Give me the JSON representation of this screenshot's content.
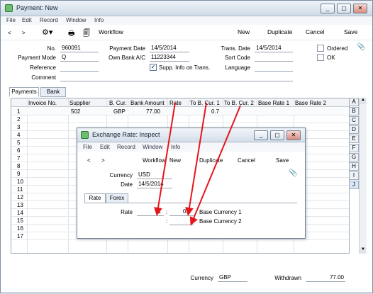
{
  "window": {
    "title": "Payment: New",
    "controls": [
      "_",
      "▢",
      "✕"
    ]
  },
  "menu": [
    "File",
    "Edit",
    "Record",
    "Window",
    "Info"
  ],
  "toolbar": {
    "prev": "<",
    "next": ">",
    "workflow": "Workflow",
    "buttons": [
      "New",
      "Duplicate",
      "Cancel",
      "Save"
    ]
  },
  "header": {
    "no_label": "No.",
    "no": "960091",
    "payment_date_label": "Payment Date",
    "payment_date": "14/5/2014",
    "trans_date_label": "Trans. Date",
    "trans_date": "14/5/2014",
    "ordered_label": "Ordered",
    "payment_mode_label": "Payment Mode",
    "payment_mode": "Q",
    "own_bank_label": "Own Bank A/C",
    "own_bank": "11223344",
    "sort_code_label": "Sort Code",
    "ok_label": "OK",
    "reference_label": "Reference",
    "supp_info_label": "Supp. Info on Trans.",
    "language_label": "Language",
    "comment_label": "Comment"
  },
  "tabs": [
    "Payments",
    "Bank"
  ],
  "grid": {
    "columns": [
      "Invoice No.",
      "Supplier",
      "B. Cur.",
      "Bank Amount",
      "Rate",
      "To B. Cur. 1",
      "To B. Cur. 2",
      "Base Rate 1",
      "Base Rate 2"
    ],
    "row1": {
      "n": "1",
      "supplier": "502",
      "cur": "GBP",
      "amount": "77.00",
      "to1": "0.7"
    },
    "row_numbers": [
      "2",
      "3",
      "4",
      "5",
      "6",
      "7",
      "8",
      "9",
      "10",
      "11",
      "12",
      "13",
      "14",
      "15",
      "16",
      "17"
    ]
  },
  "side_tabs": [
    "A",
    "B",
    "C",
    "D",
    "E",
    "F",
    "G",
    "H",
    "I",
    "J"
  ],
  "footer": {
    "currency_label": "Currency",
    "currency": "GBP",
    "withdrawn_label": "Withdrawn",
    "withdrawn": "77.00"
  },
  "dialog": {
    "title": "Exchange Rate: Inspect",
    "menu": [
      "File",
      "Edit",
      "Record",
      "Window",
      "Info"
    ],
    "prev": "<",
    "next": ">",
    "buttons": [
      "Workflow",
      "New",
      "Duplicate",
      "Cancel",
      "Save"
    ],
    "currency_label": "Currency",
    "currency": "USD",
    "date_label": "Date",
    "date": "14/5/2014",
    "tabs": [
      "Rate",
      "Forex"
    ],
    "rate_label": "Rate",
    "rate1": "1",
    "colon": ":",
    "rate2": "0.6",
    "base1_label": "Base Currency 1",
    "base2_label": "Base Currency 2"
  },
  "colors": {
    "arrow": "#e8141b",
    "accent": "#2d7b38"
  }
}
